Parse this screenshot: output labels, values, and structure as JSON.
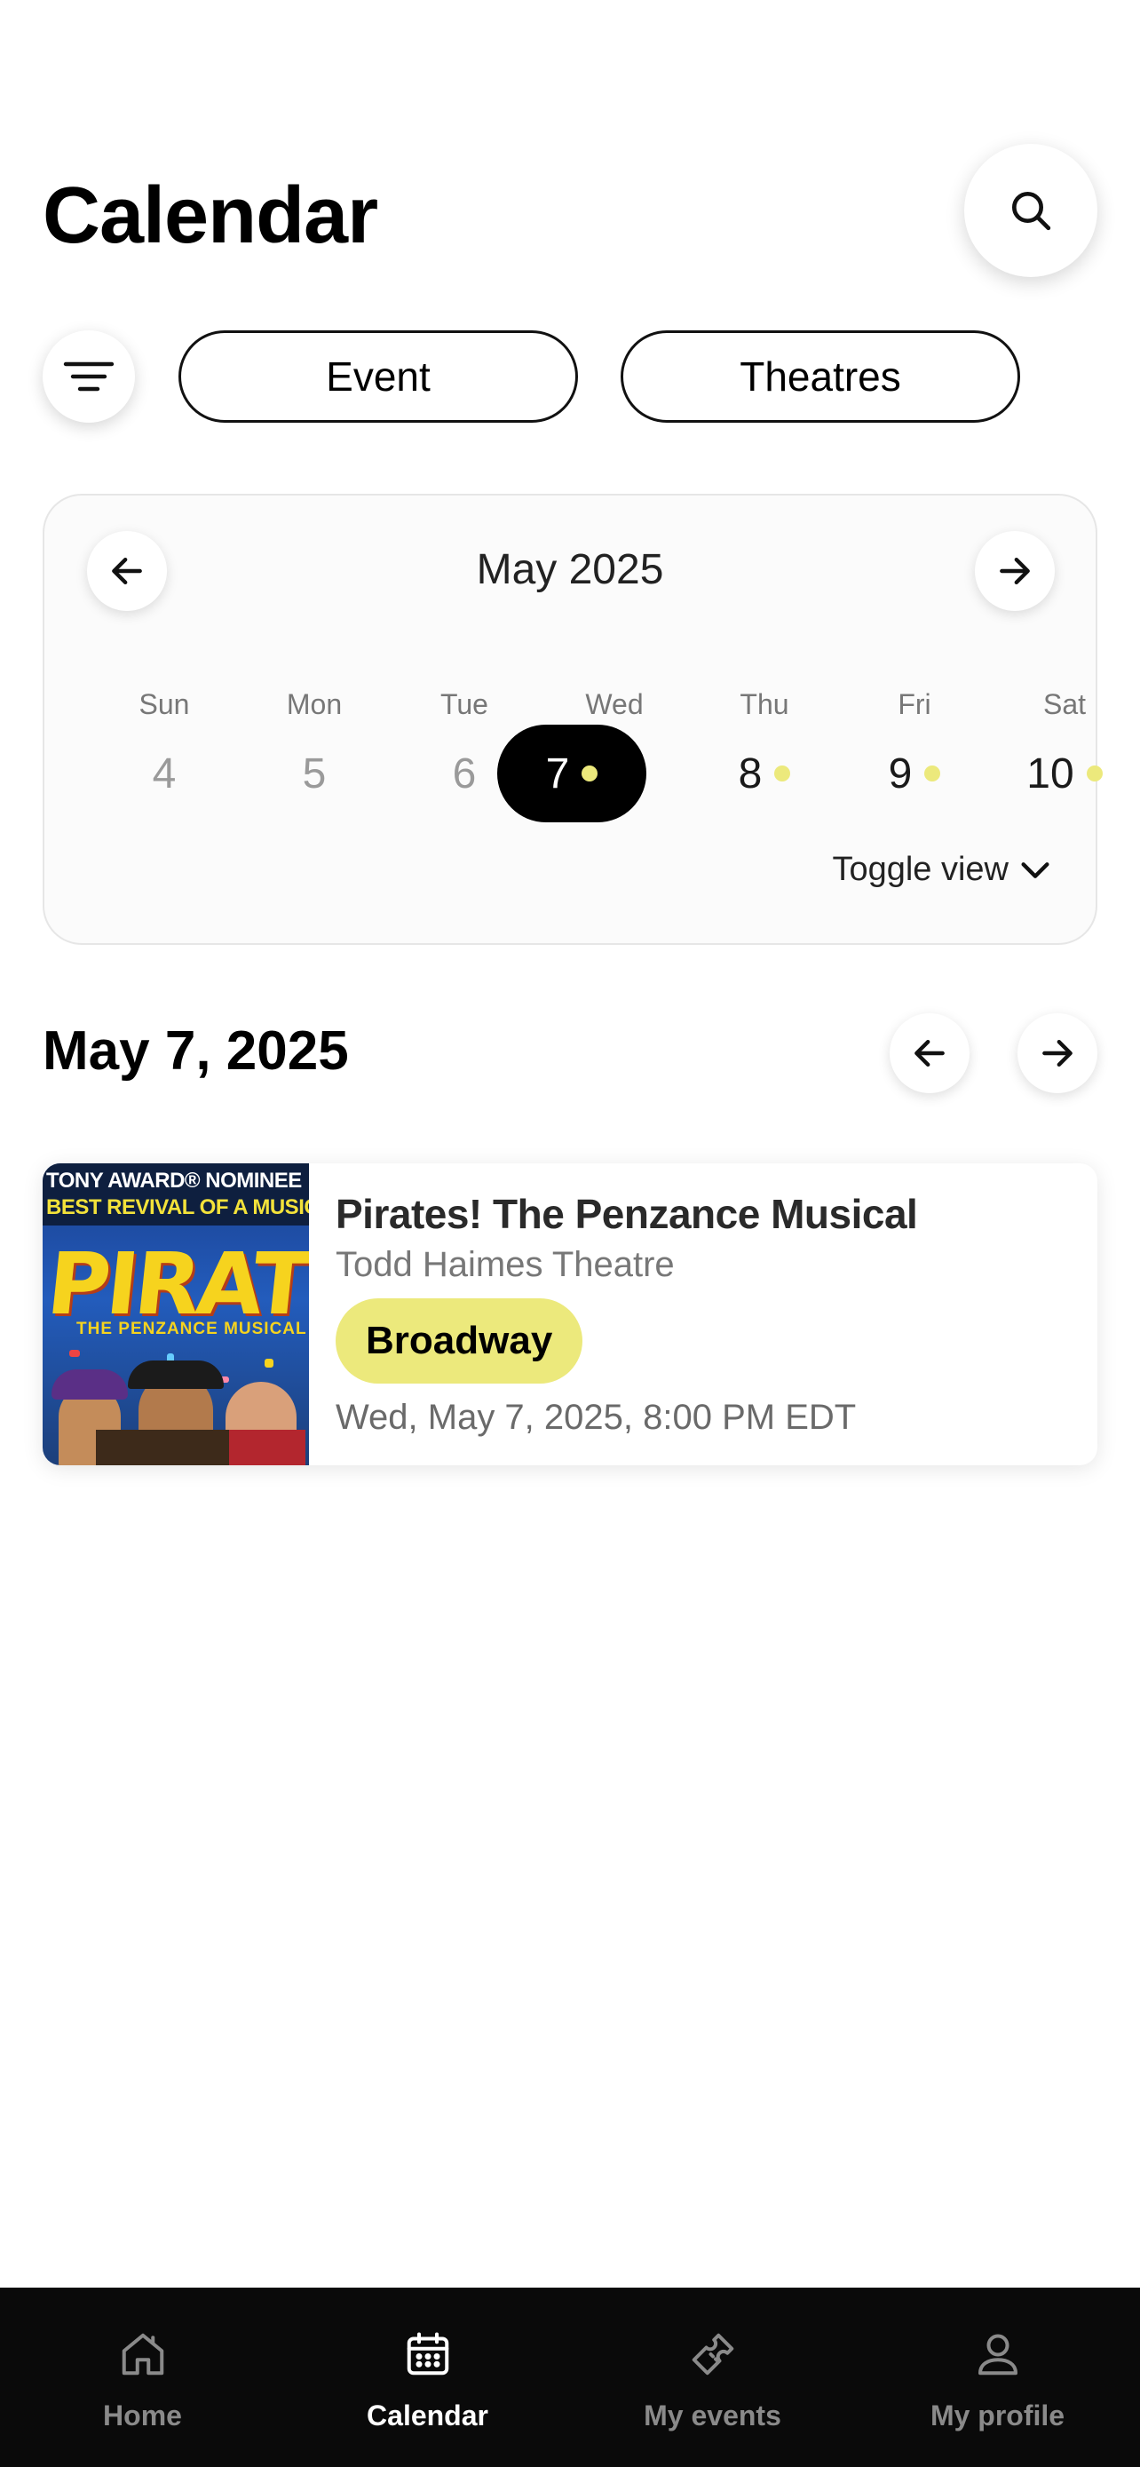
{
  "header": {
    "title": "Calendar"
  },
  "filters": {
    "event_label": "Event",
    "theatres_label": "Theatres"
  },
  "calendar": {
    "month_label": "May 2025",
    "toggle_label": "Toggle view",
    "days": [
      {
        "dow": "Sun",
        "date": "4",
        "state": "muted",
        "has_event": false
      },
      {
        "dow": "Mon",
        "date": "5",
        "state": "muted",
        "has_event": false
      },
      {
        "dow": "Tue",
        "date": "6",
        "state": "muted",
        "has_event": false
      },
      {
        "dow": "Wed",
        "date": "7",
        "state": "selected",
        "has_event": true
      },
      {
        "dow": "Thu",
        "date": "8",
        "state": "normal",
        "has_event": true
      },
      {
        "dow": "Fri",
        "date": "9",
        "state": "normal",
        "has_event": true
      },
      {
        "dow": "Sat",
        "date": "10",
        "state": "normal",
        "has_event": true
      }
    ],
    "event_dot_color": "#ece97c"
  },
  "day_view": {
    "heading": "May 7, 2025"
  },
  "events": [
    {
      "title": "Pirates! The Penzance Musical",
      "venue": "Todd Haimes Theatre",
      "badge": "Broadway",
      "datetime": "Wed, May 7, 2025, 8:00 PM EDT",
      "poster": {
        "line1": "TONY AWARD® NOMINEE",
        "line2": "BEST REVIVAL OF A MUSICAL",
        "title": "PIRATES!",
        "subtitle": "THE PENZANCE MUSICAL"
      }
    }
  ],
  "tabbar": {
    "tabs": [
      {
        "label": "Home",
        "icon": "home-icon",
        "active": false
      },
      {
        "label": "Calendar",
        "icon": "calendar-icon",
        "active": true
      },
      {
        "label": "My events",
        "icon": "ticket-icon",
        "active": false
      },
      {
        "label": "My profile",
        "icon": "profile-icon",
        "active": false
      }
    ]
  },
  "colors": {
    "accent": "#ece97c",
    "tabbar_bg": "#0a0a0a"
  }
}
